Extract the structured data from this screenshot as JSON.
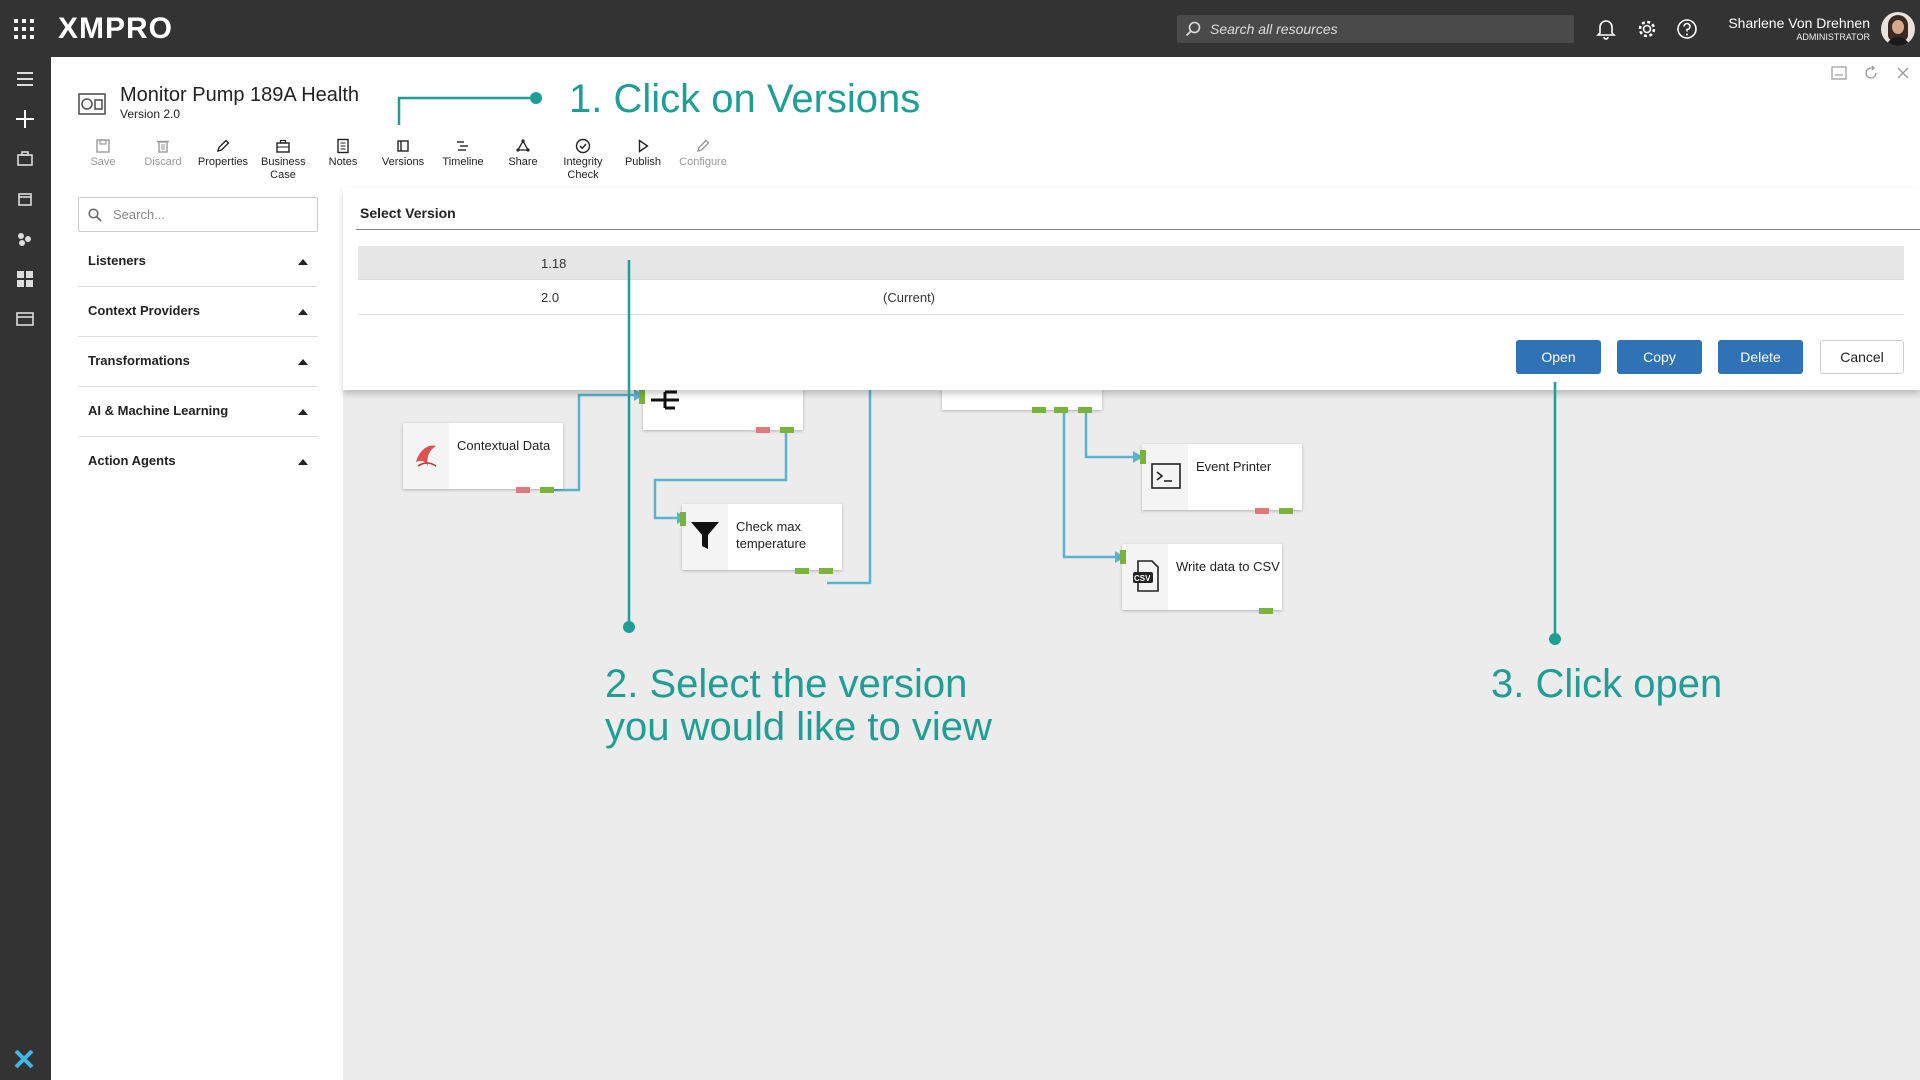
{
  "brand": {
    "logo_text": "XMPRO",
    "accent": "#1f9e96",
    "primary_button": "#2f73b6"
  },
  "header": {
    "search_placeholder": "Search all resources",
    "user_name": "Sharlene Von Drehnen",
    "user_role": "ADMINISTRATOR"
  },
  "stream": {
    "title": "Monitor Pump 189A Health",
    "version": "Version 2.0"
  },
  "toolbar": [
    {
      "label": "Save",
      "icon": "save-icon",
      "enabled": false
    },
    {
      "label": "Discard",
      "icon": "trash-icon",
      "enabled": false
    },
    {
      "label": "Properties",
      "icon": "pencil-icon",
      "enabled": true
    },
    {
      "label": "Business Case",
      "icon": "briefcase-icon",
      "enabled": true
    },
    {
      "label": "Notes",
      "icon": "notes-icon",
      "enabled": true
    },
    {
      "label": "Versions",
      "icon": "versions-icon",
      "enabled": true
    },
    {
      "label": "Timeline",
      "icon": "timeline-icon",
      "enabled": true
    },
    {
      "label": "Share",
      "icon": "share-icon",
      "enabled": true
    },
    {
      "label": "Integrity Check",
      "icon": "check-circle-icon",
      "enabled": true
    },
    {
      "label": "Publish",
      "icon": "play-icon",
      "enabled": true
    },
    {
      "label": "Configure",
      "icon": "pencil-icon",
      "enabled": false
    }
  ],
  "sidebar": {
    "search_placeholder": "Search...",
    "categories": [
      "Listeners",
      "Context Providers",
      "Transformations",
      "AI & Machine Learning",
      "Action Agents"
    ]
  },
  "dialog": {
    "title": "Select Version",
    "versions": [
      {
        "version": "1.18",
        "note": ""
      },
      {
        "version": "2.0",
        "note": "(Current)"
      }
    ],
    "buttons": {
      "open": "Open",
      "copy": "Copy",
      "delete": "Delete",
      "cancel": "Cancel"
    }
  },
  "nodes": {
    "contextual": "Contextual Data",
    "check_max": "Check max temperature",
    "event_printer": "Event Printer",
    "write_csv": "Write data to CSV",
    "csv_badge": "CSV"
  },
  "annotations": {
    "step1": "1. Click on Versions",
    "step2_line1": "2. Select the version",
    "step2_line2": "you would like to view",
    "step3": "3. Click open"
  }
}
